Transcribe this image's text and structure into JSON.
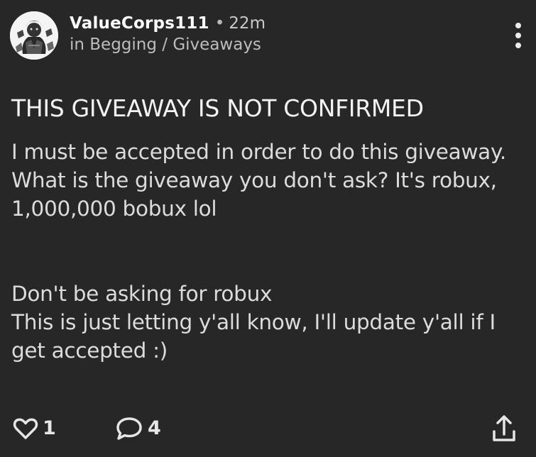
{
  "post": {
    "author": "ValueCorps111",
    "separator": "•",
    "time": "22m",
    "community": "in Begging / Giveaways",
    "title": "THIS GIVEAWAY IS NOT CONFIRMED",
    "body": "I must be accepted in order to do this giveaway. What is the giveaway you don't ask? It's robux, 1,000,000 bobux lol\n\n\nDon't be asking for robux\nThis is just letting y'all know, I'll update y'all if I get accepted :)"
  },
  "actions": {
    "likes": "1",
    "comments": "4"
  },
  "icons": {
    "menu": "more-vertical-icon",
    "like": "heart-icon",
    "comment": "comment-bubble-icon",
    "share": "share-upload-icon"
  },
  "colors": {
    "background": "#272727",
    "text": "#ececec",
    "muted": "#bdbdbd"
  }
}
